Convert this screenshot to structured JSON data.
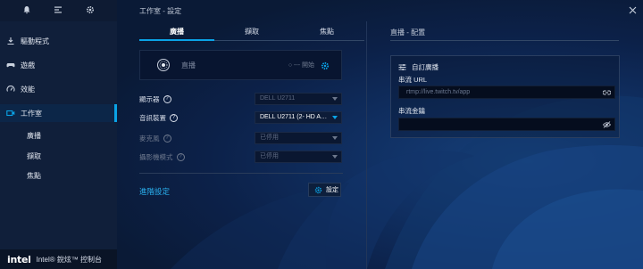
{
  "app": {
    "window_title": "工作室 - 設定",
    "footer_text": "Intel® 銳炫™ 控制台",
    "logo_text": "intel"
  },
  "sidebar": {
    "items": [
      {
        "label": "驅動程式",
        "icon": "download-icon"
      },
      {
        "label": "遊戲",
        "icon": "gamepad-icon"
      },
      {
        "label": "效能",
        "icon": "gauge-icon"
      },
      {
        "label": "工作室",
        "icon": "camera-icon",
        "active": true
      }
    ],
    "subitems": [
      "廣播",
      "擷取",
      "焦點"
    ]
  },
  "tabs": [
    {
      "label": "廣播",
      "active": true
    },
    {
      "label": "擷取",
      "active": false
    },
    {
      "label": "焦點",
      "active": false
    }
  ],
  "broadcast": {
    "label": "直播",
    "status": "○ ---  開始"
  },
  "settings_rows": [
    {
      "label": "顯示器",
      "value": "DELL U2711",
      "enabled": false
    },
    {
      "label": "音訊裝置",
      "value": "DELL U2711 (2- HD A…",
      "enabled": true
    },
    {
      "label": "麥克風",
      "value": "已停用",
      "enabled": false
    },
    {
      "label": "攝影機模式",
      "value": "已停用",
      "enabled": false
    }
  ],
  "advanced": {
    "link_label": "進階設定",
    "button_label": "設定"
  },
  "right_panel": {
    "header": "直播 - 配置",
    "title": "自訂廣播",
    "stream_url_label": "串流 URL",
    "stream_url_placeholder": "rtmp://live.twitch.tv/app",
    "stream_key_label": "串流金鑰",
    "stream_key_value": ""
  },
  "colors": {
    "accent": "#0aa3e6",
    "sidebar_bg": "#101f3a",
    "main_bg": "#0c2149"
  }
}
